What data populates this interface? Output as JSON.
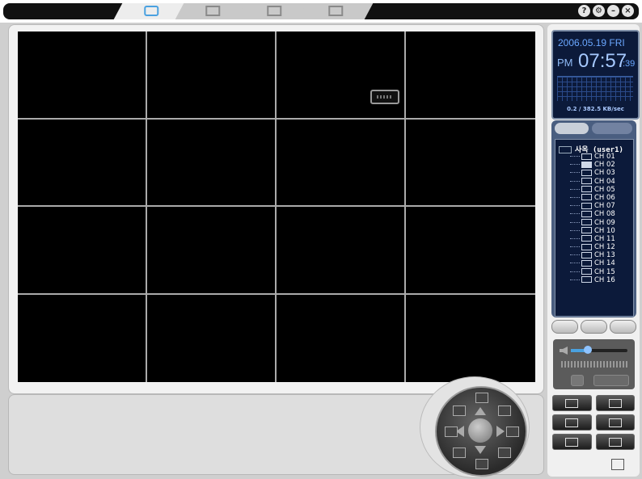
{
  "tabs": [
    {
      "name": "live-view",
      "active": true
    },
    {
      "name": "playback",
      "active": false
    },
    {
      "name": "search",
      "active": false
    },
    {
      "name": "setup",
      "active": false
    }
  ],
  "window_buttons": {
    "help": "?",
    "settings": "⚙",
    "minimize": "–",
    "close": "×"
  },
  "clock": {
    "date": "2006.05.19 FRI",
    "ampm": "PM",
    "time": "07:57",
    "seconds": ":39",
    "rate": "0.2 / 382.5 KB/sec"
  },
  "camera_tree": {
    "root_label": "사옥 (user1)",
    "channels": [
      "CH 01",
      "CH 02",
      "CH 03",
      "CH 04",
      "CH 05",
      "CH 06",
      "CH 07",
      "CH 08",
      "CH 09",
      "CH 10",
      "CH 11",
      "CH 12",
      "CH 13",
      "CH 14",
      "CH 15",
      "CH 16"
    ],
    "selected": "CH 02"
  },
  "audio": {
    "volume": 0.3
  },
  "colors": {
    "accent": "#4aa1e0",
    "panel_dark": "#0c1a3a",
    "video_bg": "#000000"
  }
}
